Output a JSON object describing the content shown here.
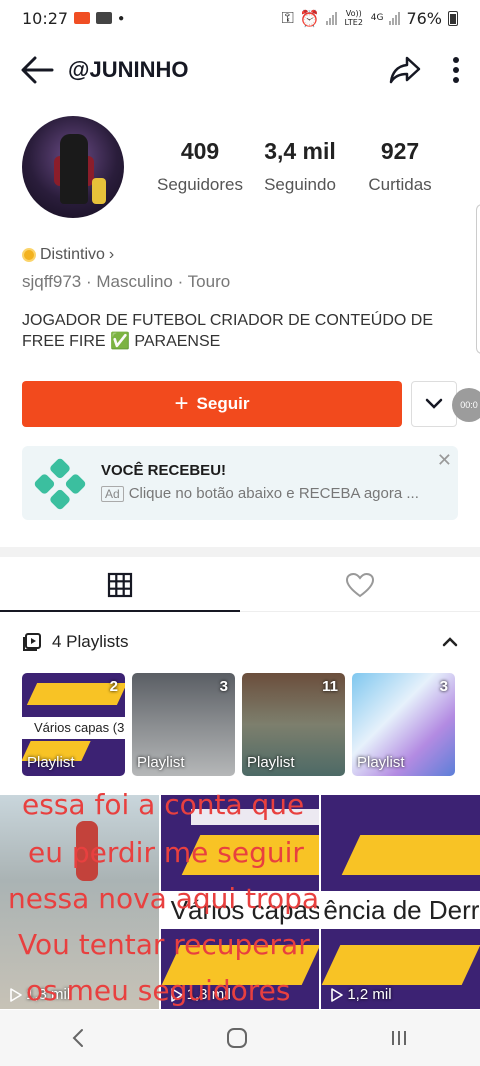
{
  "status_bar": {
    "time": "10:27",
    "signal_labels": [
      "Vo)) LTE2",
      "4G"
    ],
    "battery": "76%"
  },
  "header": {
    "username": "@JUNINHO"
  },
  "stats": [
    {
      "value": "409",
      "label": "Seguidores"
    },
    {
      "value": "3,4 mil",
      "label": "Seguindo"
    },
    {
      "value": "927",
      "label": "Curtidas"
    }
  ],
  "profile": {
    "badge": "Distintivo",
    "meta": "sjqff973 · Masculino · Touro",
    "bio_line1": "JOGADOR DE FUTEBOL CRIADOR DE CONTEÚDO DE",
    "bio_line2": "FREE FIRE ✅ PARAENSE"
  },
  "actions": {
    "follow_label": "Seguir",
    "floating_bubble": "00:0"
  },
  "ad": {
    "title": "VOCÊ RECEBEU!",
    "tag": "Ad",
    "description": "Clique no botão abaixo e RECEBA agora ..."
  },
  "playlists": {
    "header": "4 Playlists",
    "items": [
      {
        "count": "2",
        "label": "Playlist",
        "cover_text": "Vários capas (3"
      },
      {
        "count": "3",
        "label": "Playlist"
      },
      {
        "count": "11",
        "label": "Playlist"
      },
      {
        "count": "3",
        "label": "Playlist"
      }
    ]
  },
  "videos": [
    {
      "views": "1,3 mil"
    },
    {
      "views": "1,3 mil",
      "cover_text": "Vários capas"
    },
    {
      "views": "1,2 mil",
      "cover_text": "ência de Derrub"
    }
  ],
  "overlay_text": [
    "essa foi a conta que",
    "eu perdir me seguir",
    "nessa nova aqui tropa",
    "Vou tentar recuperar",
    "os meu seguidores"
  ],
  "colors": {
    "accent": "#f24a1d",
    "overlay_text": "#e8403f",
    "ad_bg": "#eef5f7"
  },
  "icons": [
    "back-arrow-icon",
    "share-icon",
    "more-vertical-icon",
    "chevron-down-icon",
    "grid-icon",
    "heart-icon",
    "playlist-icon",
    "chevron-up-icon",
    "play-icon",
    "nav-back-icon",
    "nav-home-icon",
    "nav-recents-icon"
  ]
}
